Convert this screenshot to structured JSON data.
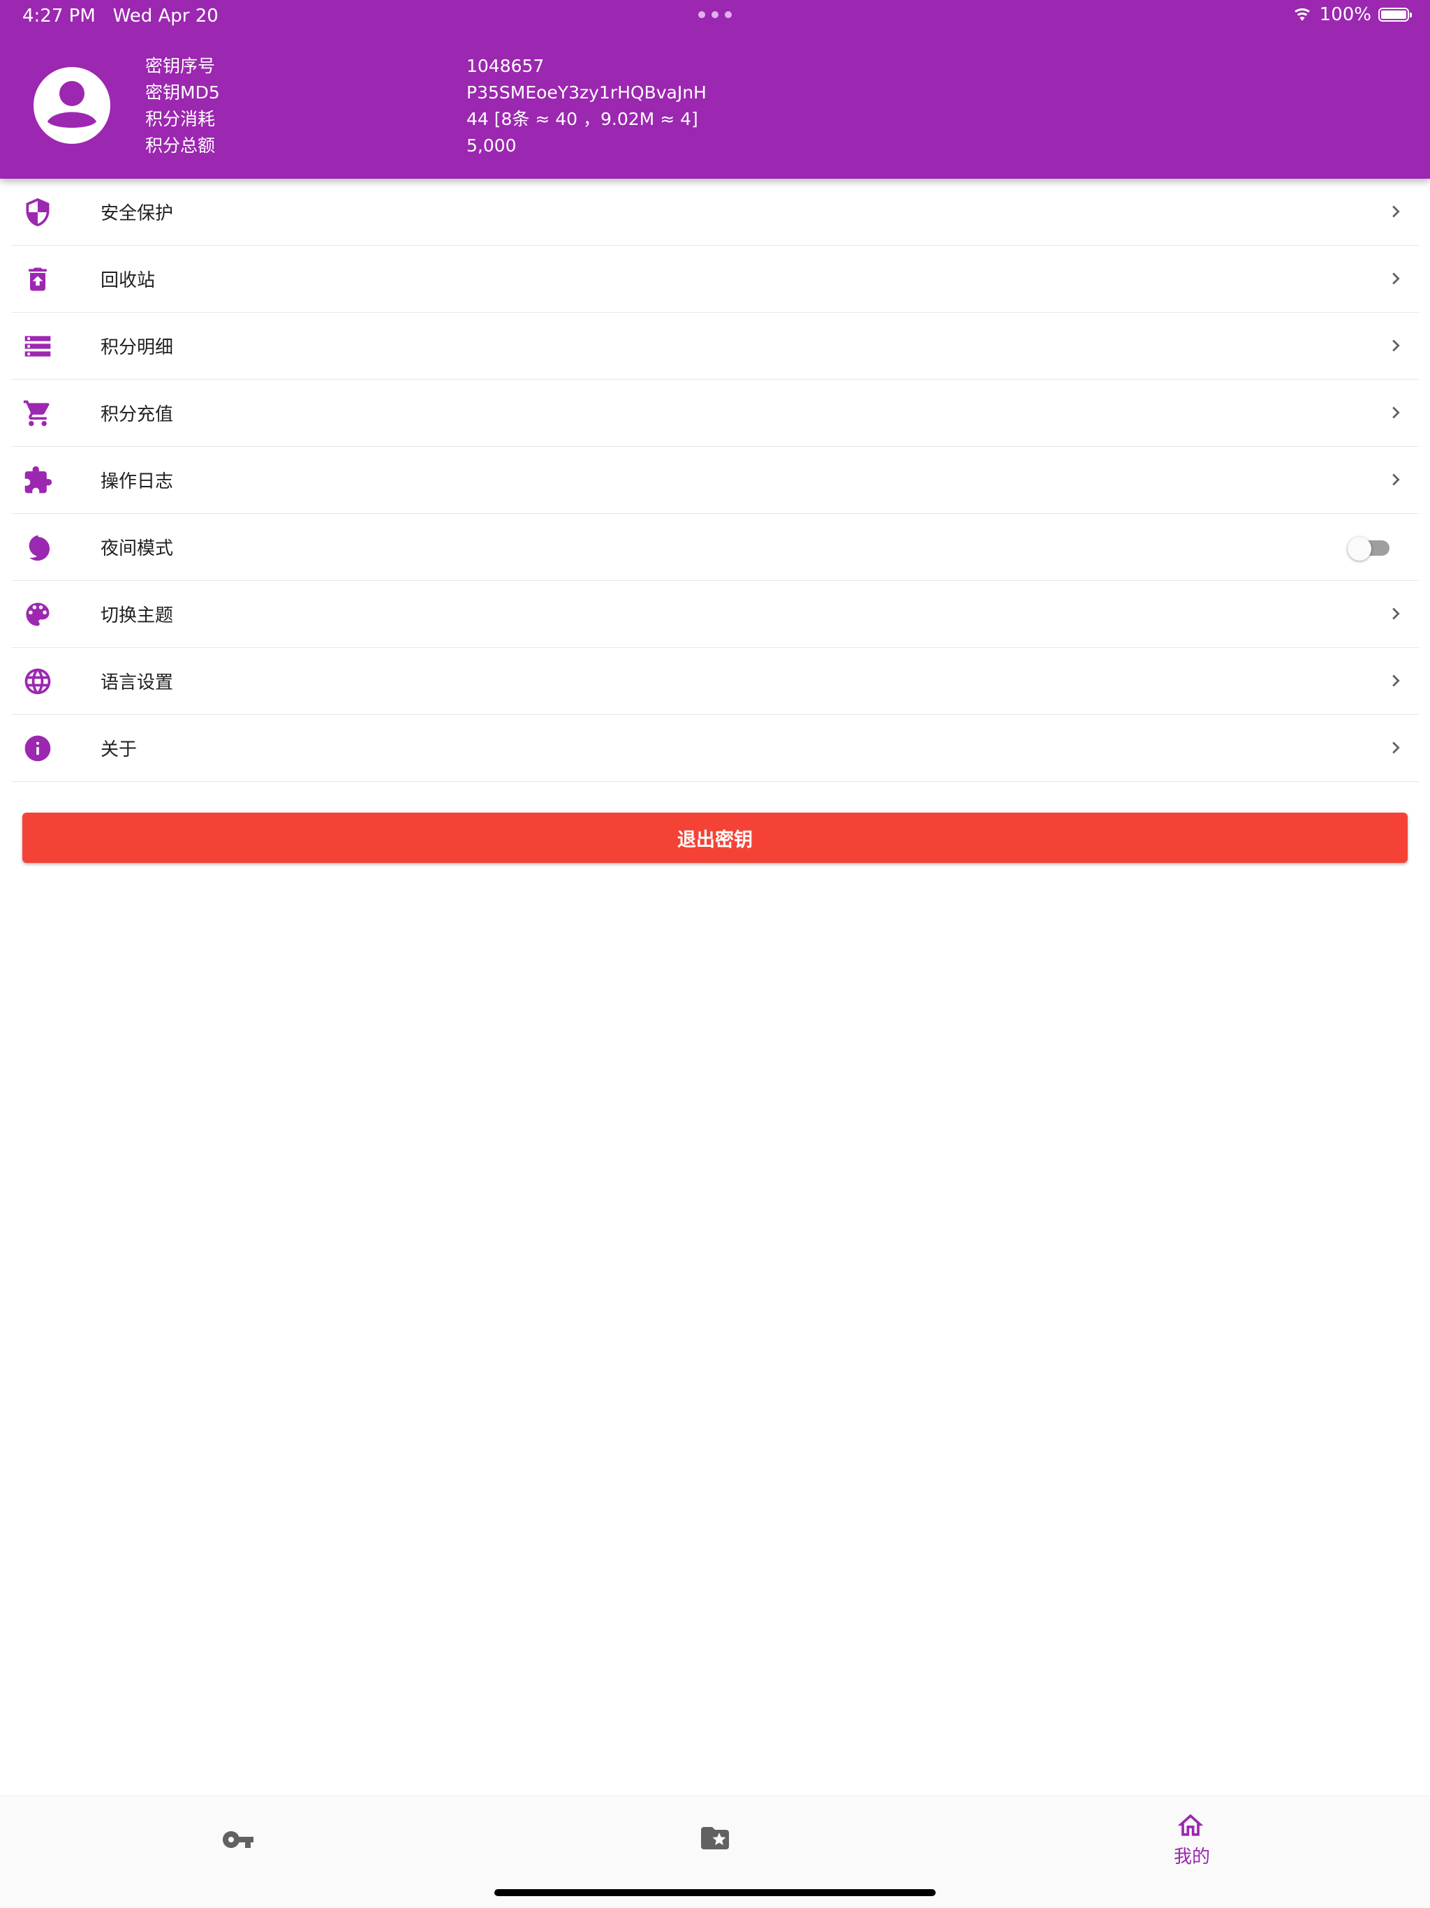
{
  "colors": {
    "primary": "#9c27b0",
    "danger": "#f44336",
    "chevron": "#616161",
    "inactive_nav": "#616161"
  },
  "status_bar": {
    "time": "4:27 PM",
    "date": "Wed Apr 20",
    "battery_text": "100%",
    "battery_level": 1.0
  },
  "profile": {
    "rows": [
      {
        "label": "密钥序号",
        "value": "1048657"
      },
      {
        "label": "密钥MD5",
        "value": "P35SMEoeY3zy1rHQBvaJnH"
      },
      {
        "label": "积分消耗",
        "value": "44  [8条 ≈ 40 ，9.02M ≈ 4]"
      },
      {
        "label": "积分总额",
        "value": "5,000"
      }
    ]
  },
  "menu": {
    "items": [
      {
        "label": "安全保护",
        "icon": "shield-icon"
      },
      {
        "label": "回收站",
        "icon": "restore-from-trash-icon"
      },
      {
        "label": "积分明细",
        "icon": "list-storage-icon"
      },
      {
        "label": "积分充值",
        "icon": "cart-icon"
      },
      {
        "label": "操作日志",
        "icon": "puzzle-icon"
      },
      {
        "label": "夜间模式",
        "icon": "moon-icon",
        "toggle_on": false
      },
      {
        "label": "切换主题",
        "icon": "palette-icon"
      },
      {
        "label": "语言设置",
        "icon": "globe-icon"
      },
      {
        "label": "关于",
        "icon": "info-icon"
      }
    ]
  },
  "logout_label": "退出密钥",
  "bottom_nav": {
    "items": [
      {
        "icon": "key-icon",
        "label": "",
        "active": false
      },
      {
        "icon": "folder-star-icon",
        "label": "",
        "active": false
      },
      {
        "icon": "home-icon",
        "label": "我的",
        "active": true
      }
    ]
  }
}
